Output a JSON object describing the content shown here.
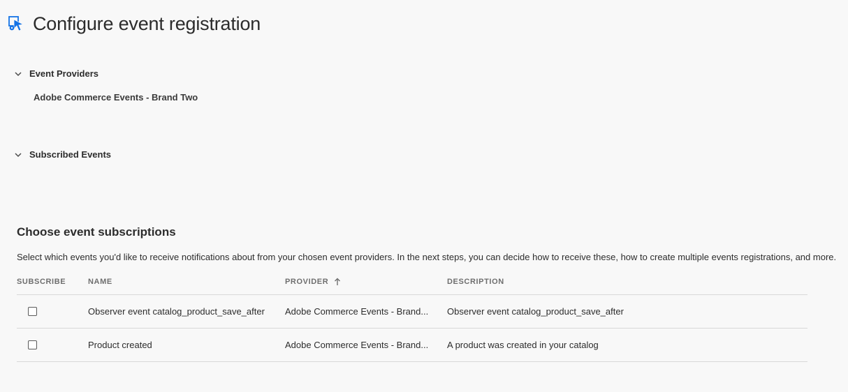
{
  "header": {
    "title": "Configure event registration",
    "icon": "event-registration-icon"
  },
  "sections": {
    "event_providers": {
      "title": "Event Providers",
      "provider": "Adobe Commerce Events - Brand Two"
    },
    "subscribed_events": {
      "title": "Subscribed Events"
    }
  },
  "subscriptions": {
    "title": "Choose event subscriptions",
    "description": "Select which events you'd like to receive notifications about from your chosen event providers. In the next steps, you can decide how to receive these, how to create multiple events registrations, and more.",
    "columns": {
      "subscribe": "SUBSCRIBE",
      "name": "NAME",
      "provider": "PROVIDER",
      "description": "DESCRIPTION"
    },
    "sort": "provider-ascending",
    "rows": [
      {
        "checked": false,
        "name": "Observer event catalog_product_save_after",
        "provider": "Adobe Commerce Events - Brand...",
        "description": "Observer event catalog_product_save_after"
      },
      {
        "checked": false,
        "name": "Product created",
        "provider": "Adobe Commerce Events - Brand...",
        "description": "A product was created in your catalog"
      }
    ]
  },
  "colors": {
    "accent": "#1473e6",
    "background": "#f8f8f8",
    "text": "#2c2c2c",
    "muted": "#6e6e6e",
    "divider": "#d8d8d8"
  }
}
